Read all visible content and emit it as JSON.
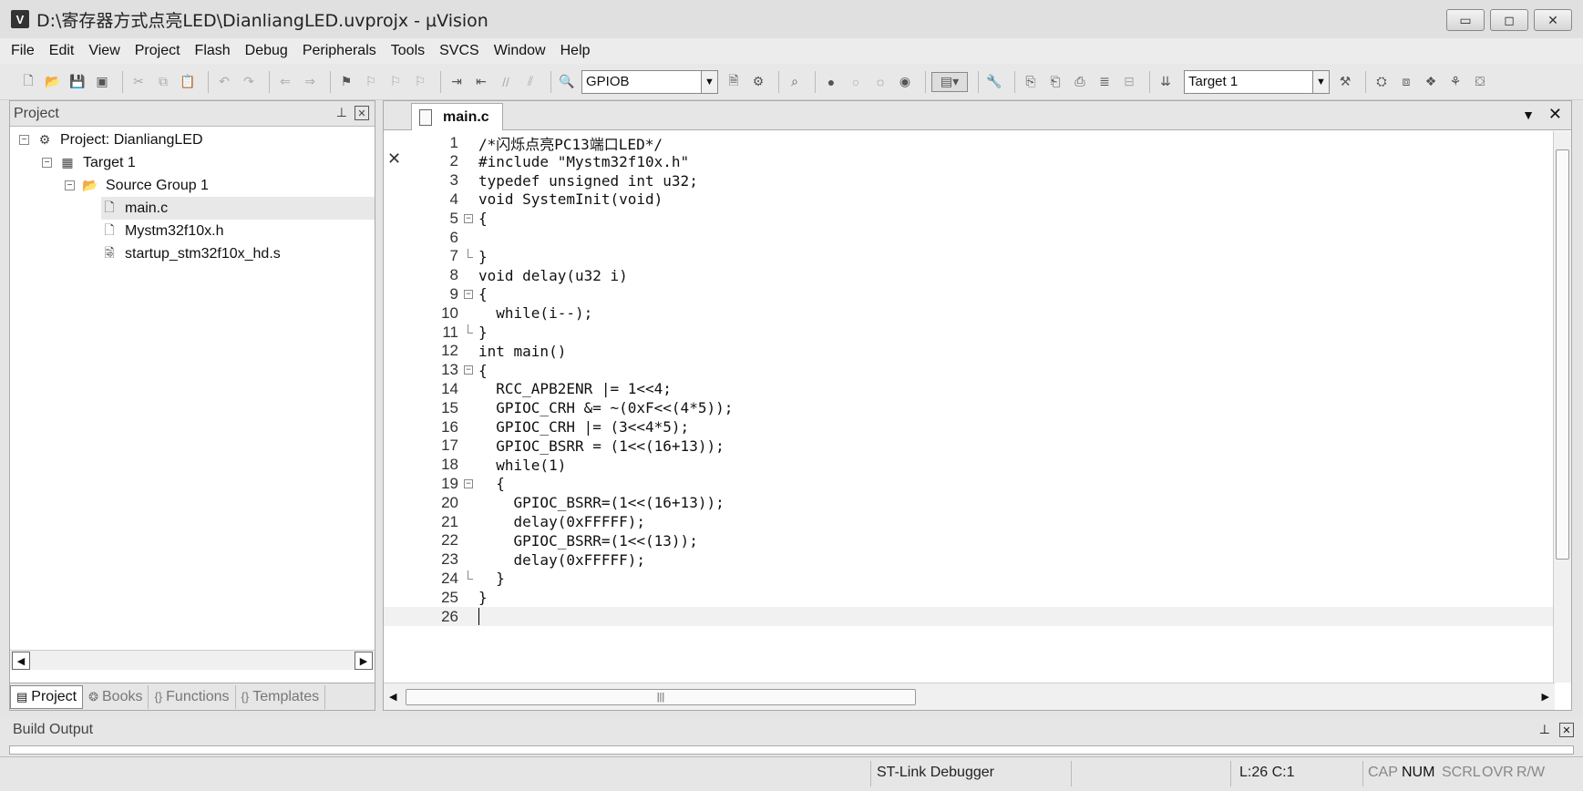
{
  "window": {
    "app_icon_label": "V",
    "title": "D:\\寄存器方式点亮LED\\DianliangLED.uvprojx - µVision",
    "minimize": "▭",
    "maximize": "◻",
    "close": "✕"
  },
  "menu": [
    "File",
    "Edit",
    "View",
    "Project",
    "Flash",
    "Debug",
    "Peripherals",
    "Tools",
    "SVCS",
    "Window",
    "Help"
  ],
  "toolbar": {
    "find_combo_value": "GPIOB",
    "target_combo_value": "Target 1"
  },
  "project_panel": {
    "header": "Project",
    "tree": {
      "project": "Project: DianliangLED",
      "target": "Target 1",
      "group": "Source Group 1",
      "files": [
        "main.c",
        "Mystm32f10x.h",
        "startup_stm32f10x_hd.s"
      ]
    },
    "tabs": [
      {
        "label": "Project",
        "active": true
      },
      {
        "label": "Books",
        "active": false
      },
      {
        "label": "Functions",
        "active": false
      },
      {
        "label": "Templates",
        "active": false
      }
    ]
  },
  "editor": {
    "tab_label": "main.c",
    "current_line": 26,
    "lines": [
      {
        "n": "1",
        "text": "/*闪烁点亮PC13端口LED*/"
      },
      {
        "n": "2",
        "text": "#include \"Mystm32f10x.h\""
      },
      {
        "n": "3",
        "text": "typedef unsigned int u32;"
      },
      {
        "n": "4",
        "text": "void SystemInit(void)"
      },
      {
        "n": "5",
        "text": "{"
      },
      {
        "n": "6",
        "text": ""
      },
      {
        "n": "7",
        "text": "}"
      },
      {
        "n": "8",
        "text": "void delay(u32 i)"
      },
      {
        "n": "9",
        "text": "{"
      },
      {
        "n": "10",
        "text": "  while(i--);"
      },
      {
        "n": "11",
        "text": "}"
      },
      {
        "n": "12",
        "text": "int main()"
      },
      {
        "n": "13",
        "text": "{"
      },
      {
        "n": "14",
        "text": "  RCC_APB2ENR |= 1<<4;"
      },
      {
        "n": "15",
        "text": "  GPIOC_CRH &= ~(0xF<<(4*5));"
      },
      {
        "n": "16",
        "text": "  GPIOC_CRH |= (3<<4*5);"
      },
      {
        "n": "17",
        "text": "  GPIOC_BSRR = (1<<(16+13));"
      },
      {
        "n": "18",
        "text": "  while(1)"
      },
      {
        "n": "19",
        "text": "  {"
      },
      {
        "n": "20",
        "text": "    GPIOC_BSRR=(1<<(16+13));"
      },
      {
        "n": "21",
        "text": "    delay(0xFFFFF);"
      },
      {
        "n": "22",
        "text": "    GPIOC_BSRR=(1<<(13));"
      },
      {
        "n": "23",
        "text": "    delay(0xFFFFF);"
      },
      {
        "n": "24",
        "text": "  }"
      },
      {
        "n": "25",
        "text": "}"
      },
      {
        "n": "26",
        "text": ""
      }
    ]
  },
  "build_output": {
    "header": "Build Output"
  },
  "status_bar": {
    "debugger": "ST-Link Debugger",
    "position": "L:26 C:1",
    "indicators": [
      "CAP",
      "NUM",
      "SCRL",
      "OVR",
      "R/W"
    ]
  }
}
